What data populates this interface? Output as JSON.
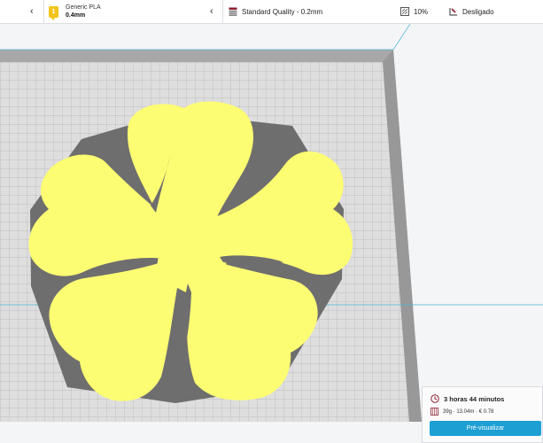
{
  "header": {
    "material": {
      "extruder_index": "1",
      "name": "Generic PLA",
      "nozzle": "0.4mm"
    },
    "profile": {
      "label": "Standard Quality - 0.2mm"
    },
    "infill": {
      "value": "10%"
    },
    "adhesion": {
      "label": "Desligado"
    }
  },
  "summary": {
    "print_time": "3 horas 44 minutos",
    "material_usage": "39g · 13.04m · € 0.78",
    "preview_label": "Pré-visualizar"
  },
  "colors": {
    "model": "#fdfd73",
    "adhesion_shadow": "#6e6e6e",
    "buildplate": "#d7d7d7",
    "buildplate_border": "#a6a6a6",
    "accent": "#1e9fd4"
  }
}
